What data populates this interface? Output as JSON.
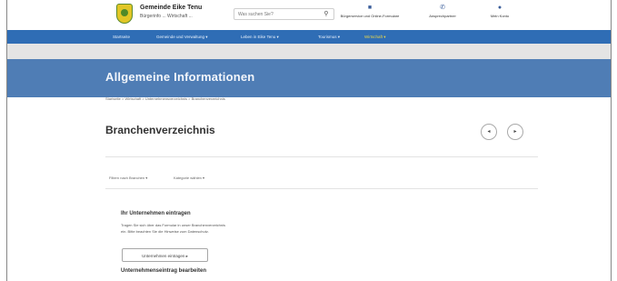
{
  "header": {
    "brand_title": "Gemeinde Eike Tenu",
    "brand_subtitle": "Bürgerinfo ... Wirtschaft ...",
    "search_placeholder": "Was suchen Sie?",
    "search_icon": "magnifier",
    "utility_links": [
      {
        "icon": "building-icon",
        "label": "Bürgerservice und Online-Formulare"
      },
      {
        "icon": "phone-icon",
        "label": "Ansprechpartner"
      },
      {
        "icon": "person-icon",
        "label": "Mein Konto"
      }
    ]
  },
  "nav": {
    "items": [
      "Startseite",
      "Gemeinde und Verwaltung ▾",
      "Leben in Eike Tenu ▾",
      "Tourismus ▾",
      "Wirtschaft ▾"
    ],
    "active_index": 4,
    "active_color": "#e9d64a",
    "bar_color": "#2f6db5"
  },
  "banner": {
    "title": "Allgemeine Informationen",
    "color": "#4f7db5"
  },
  "breadcrumb": [
    "Startseite",
    "Wirtschaft",
    "Unternehmensverzeichnis",
    "Branchenverzeichnis"
  ],
  "page": {
    "title": "Branchenverzeichnis",
    "action_buttons": [
      "◂",
      "▸"
    ]
  },
  "filters": [
    "Filtern nach Branchen ▾",
    "Kategorie wählen ▾"
  ],
  "section1": {
    "title": "Ihr Unternehmen eintragen",
    "lines": [
      "Tragen Sie sich über das Formular in unser Branchenverzeichnis",
      "ein. Bitte beachten Sie die Hinweise zum Datenschutz."
    ],
    "button_label": "Unternehmen eintragen ▸"
  },
  "section2": {
    "title": "Unternehmenseintrag bearbeiten"
  }
}
